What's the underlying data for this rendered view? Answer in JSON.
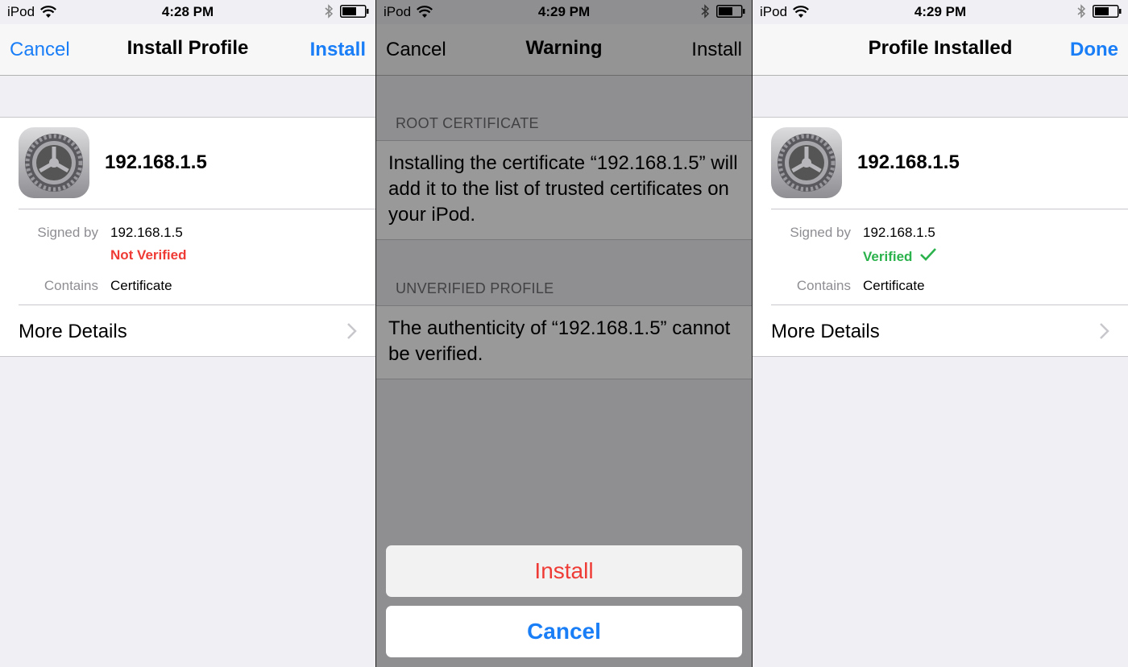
{
  "screens": [
    {
      "status": {
        "carrier": "iPod",
        "time": "4:28 PM"
      },
      "nav": {
        "left": "Cancel",
        "title": "Install Profile",
        "right": "Install"
      },
      "profile": {
        "name": "192.168.1.5",
        "signed_by_label": "Signed by",
        "signed_by_value": "192.168.1.5",
        "verification": "Not Verified",
        "contains_label": "Contains",
        "contains_value": "Certificate",
        "more_details": "More Details"
      }
    },
    {
      "status": {
        "carrier": "iPod",
        "time": "4:29 PM"
      },
      "nav": {
        "left": "Cancel",
        "title": "Warning",
        "right": "Install"
      },
      "sections": [
        {
          "header": "ROOT CERTIFICATE",
          "text": "Installing the certificate “192.168.1.5” will add it to the list of trusted certificates on your iPod."
        },
        {
          "header": "UNVERIFIED PROFILE",
          "text": "The authenticity of “192.168.1.5” cannot be verified."
        }
      ],
      "sheet": {
        "install": "Install",
        "cancel": "Cancel"
      }
    },
    {
      "status": {
        "carrier": "iPod",
        "time": "4:29 PM"
      },
      "nav": {
        "title": "Profile Installed",
        "right": "Done"
      },
      "profile": {
        "name": "192.168.1.5",
        "signed_by_label": "Signed by",
        "signed_by_value": "192.168.1.5",
        "verification": "Verified",
        "contains_label": "Contains",
        "contains_value": "Certificate",
        "more_details": "More Details"
      }
    }
  ],
  "colors": {
    "tint": "#1a7ef7",
    "not_verified": "#ef3b35",
    "verified": "#2bb24c",
    "destructive": "#ef3b35"
  },
  "icons": {
    "wifi": "wifi-icon",
    "bluetooth": "bluetooth-icon",
    "battery": "battery-icon",
    "settings": "settings-gear-icon",
    "chevron": "chevron-right-icon",
    "check": "checkmark-icon"
  }
}
